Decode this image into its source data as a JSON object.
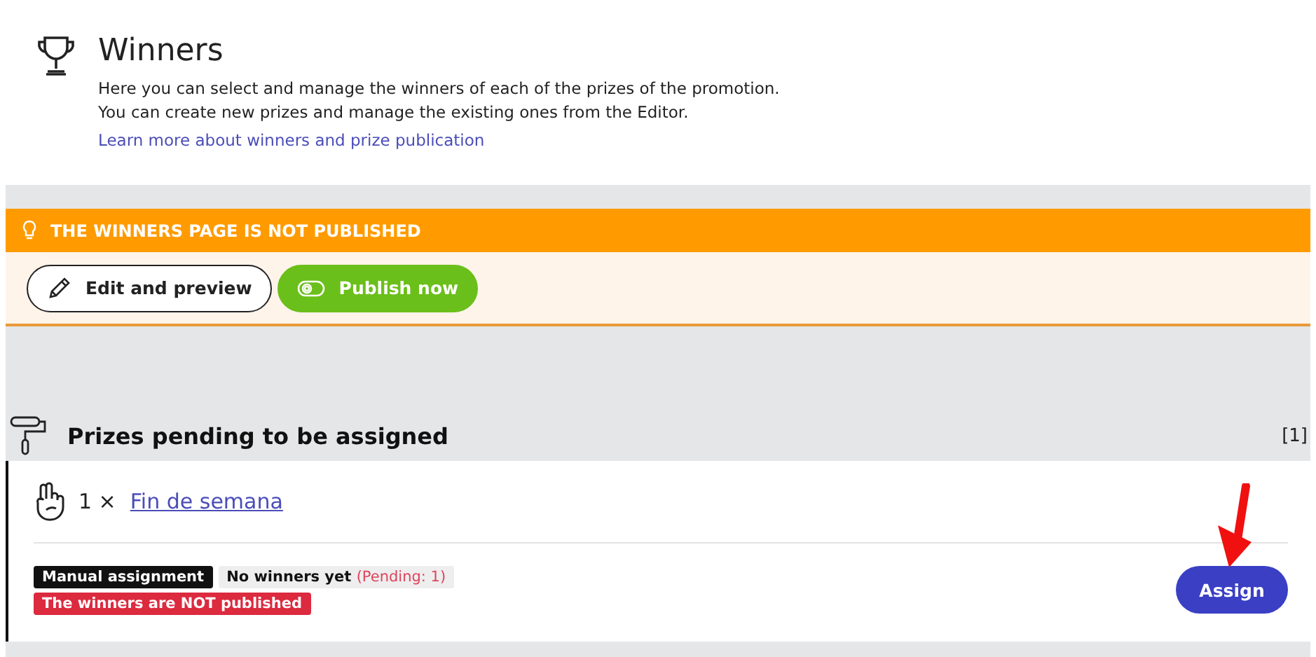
{
  "header": {
    "title": "Winners",
    "description": [
      "Here you can select and manage the winners of each of the prizes of the promotion.",
      "You can create new prizes and manage the existing ones from the Editor."
    ],
    "link": "Learn more about winners and prize publication"
  },
  "notice": {
    "text": "THE WINNERS PAGE IS NOT PUBLISHED",
    "buttons": [
      {
        "label": "Edit and preview",
        "kind": "outline"
      },
      {
        "label": "Publish now",
        "kind": "primary"
      }
    ]
  },
  "section": {
    "title": "Prizes pending to be assigned",
    "count": "[1]"
  },
  "prize": {
    "quantity": "1 ×",
    "name": "Fin de semana",
    "tags": [
      {
        "kind": "dark",
        "text": "Manual assignment"
      },
      {
        "kind": "light",
        "text": "No winners yet",
        "note": "(Pending: 1)"
      },
      {
        "kind": "danger",
        "text": "The winners are NOT published"
      }
    ],
    "button": "Assign"
  }
}
